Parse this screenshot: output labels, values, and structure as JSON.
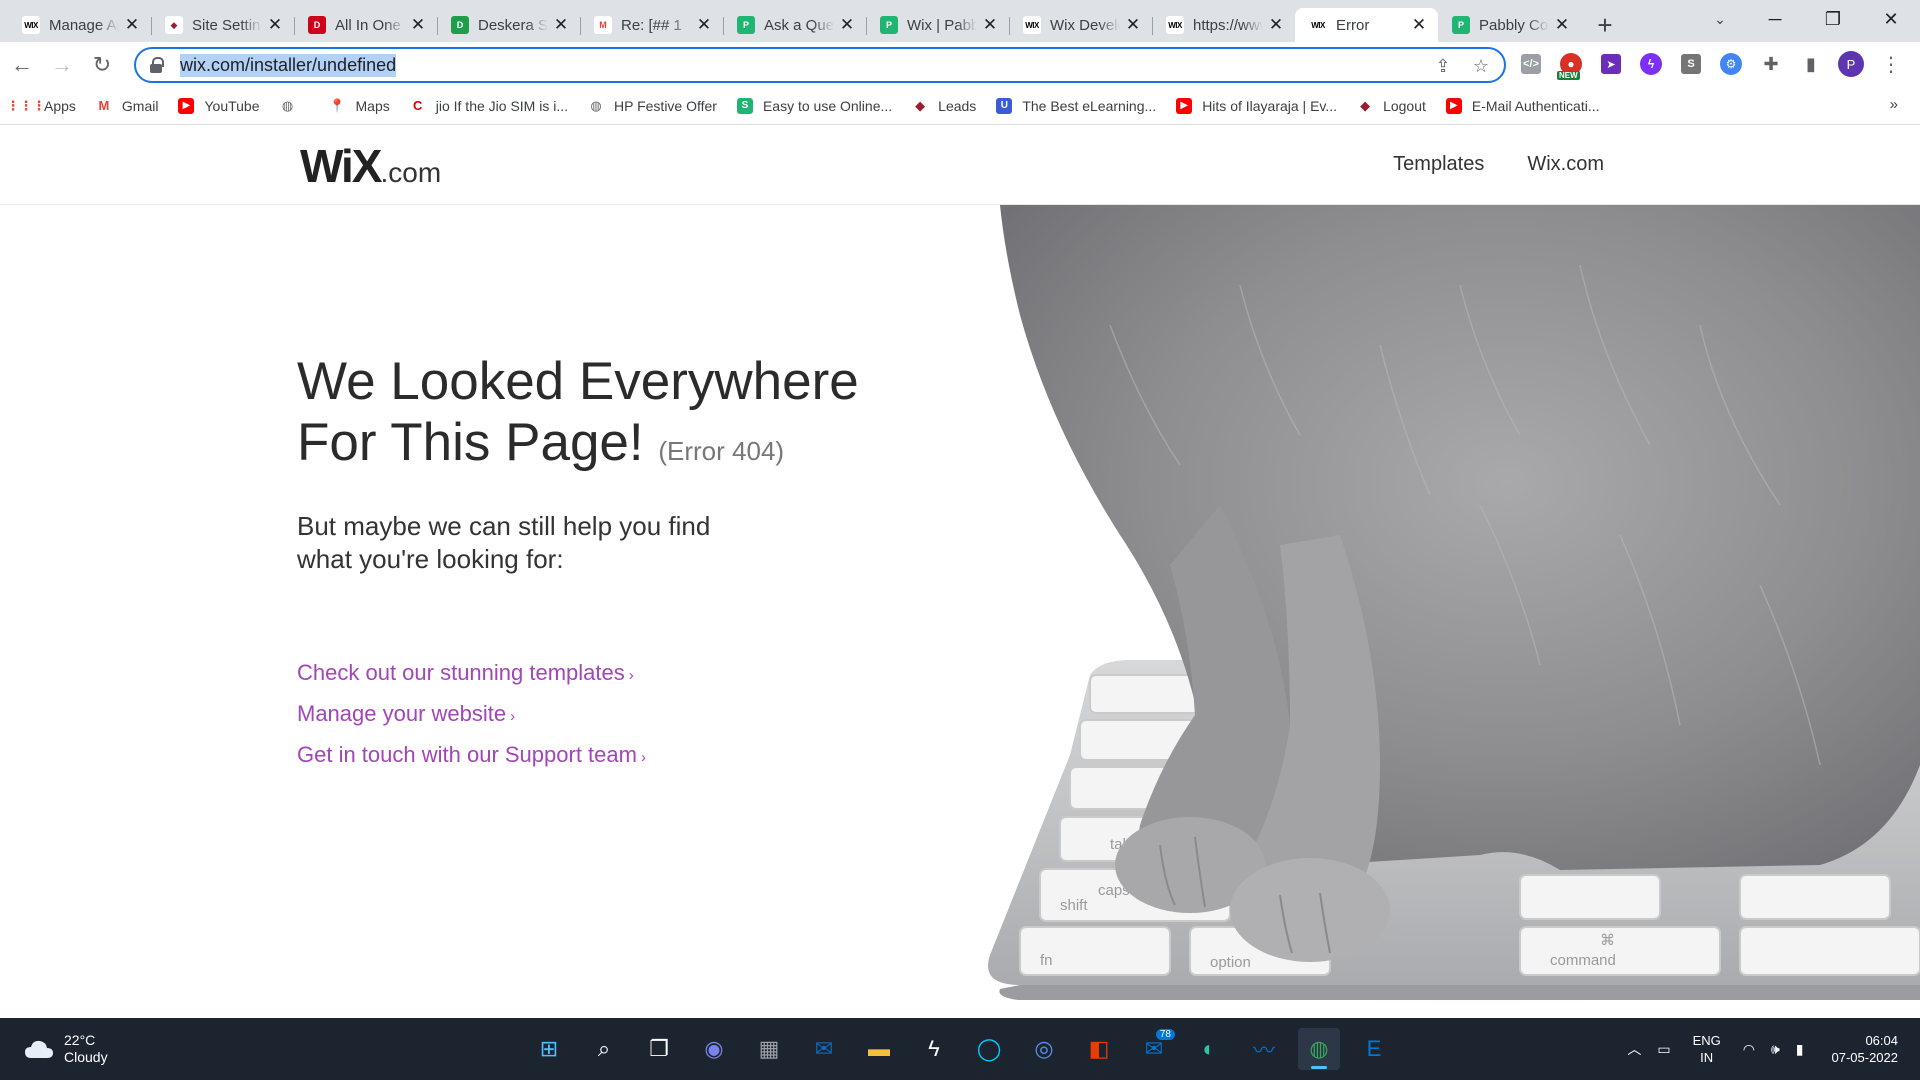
{
  "browser": {
    "tabs": [
      {
        "title": "Manage Apps",
        "favicon": "WIX",
        "fav_bg": "#ffffff",
        "fav_fg": "#000000",
        "active": false
      },
      {
        "title": "Site Settings",
        "favicon": "◆",
        "fav_bg": "#ffffff",
        "fav_fg": "#9b1c31",
        "active": false
      },
      {
        "title": "All In One",
        "favicon": "D",
        "fav_bg": "#d0021b",
        "fav_fg": "#ffffff",
        "active": false
      },
      {
        "title": "Deskera Sign",
        "favicon": "D",
        "fav_bg": "#1e9e4a",
        "fav_fg": "#ffffff",
        "active": false
      },
      {
        "title": "Re: [## 1",
        "favicon": "M",
        "fav_bg": "#ffffff",
        "fav_fg": "#ea4335",
        "active": false
      },
      {
        "title": "Ask a Question",
        "favicon": "P",
        "fav_bg": "#21b573",
        "fav_fg": "#ffffff",
        "active": false
      },
      {
        "title": "Wix | Pabbly",
        "favicon": "P",
        "fav_bg": "#21b573",
        "fav_fg": "#ffffff",
        "active": false
      },
      {
        "title": "Wix Developers",
        "favicon": "WIX",
        "fav_bg": "#ffffff",
        "fav_fg": "#000000",
        "active": false
      },
      {
        "title": "https://www",
        "favicon": "WIX",
        "fav_bg": "#ffffff",
        "fav_fg": "#000000",
        "active": false
      },
      {
        "title": "Error",
        "favicon": "WIX",
        "fav_bg": "#ffffff",
        "fav_fg": "#000000",
        "active": true
      },
      {
        "title": "Pabbly Connect",
        "favicon": "P",
        "fav_bg": "#21b573",
        "fav_fg": "#ffffff",
        "active": false
      }
    ],
    "tab_close_glyph": "✕",
    "new_tab_glyph": "+",
    "tab_search_glyph": "⌄",
    "window": {
      "minimize": "─",
      "maximize": "❐",
      "close": "✕"
    },
    "nav": {
      "back": "←",
      "forward": "→",
      "reload": "↻"
    },
    "address": {
      "url": "wix.com/installer/undefined",
      "share_glyph": "⇪",
      "star_glyph": "☆"
    },
    "extensions": [
      {
        "name": "code-extension",
        "glyph": "</>",
        "bg": "#9aa0a6",
        "shape": "sq"
      },
      {
        "name": "new-extension",
        "glyph": "●",
        "bg": "#d93025",
        "shape": "dot",
        "badge": "NEW"
      },
      {
        "name": "send-extension",
        "glyph": "➤",
        "bg": "#6c2eb9",
        "shape": "sq"
      },
      {
        "name": "bolt-extension",
        "glyph": "ϟ",
        "bg": "#7b2ff7",
        "shape": "dot"
      },
      {
        "name": "script-extension",
        "glyph": "S",
        "bg": "#757575",
        "shape": "sq"
      },
      {
        "name": "gear-extension",
        "glyph": "⚙",
        "bg": "#4285f4",
        "shape": "dot"
      }
    ],
    "puzzle_glyph": "✚",
    "sidepanel_glyph": "▮",
    "profile_initial": "P",
    "menu_glyph": "⋮",
    "bookmarks": [
      {
        "label": "Apps",
        "icon": "⋮⋮⋮",
        "bg": "#ffffff",
        "fg": "#ea4335"
      },
      {
        "label": "Gmail",
        "icon": "M",
        "bg": "#ffffff",
        "fg": "#ea4335"
      },
      {
        "label": "YouTube",
        "icon": "▶",
        "bg": "#ff0000",
        "fg": "#ffffff"
      },
      {
        "label": "",
        "icon": "◍",
        "bg": "#ffffff",
        "fg": "#5f6368"
      },
      {
        "label": "Maps",
        "icon": "📍",
        "bg": "#ffffff",
        "fg": "#34a853"
      },
      {
        "label": "jio If the Jio SIM is i...",
        "icon": "C",
        "bg": "#ffffff",
        "fg": "#d50000"
      },
      {
        "label": "HP Festive Offer",
        "icon": "◍",
        "bg": "#ffffff",
        "fg": "#5f6368"
      },
      {
        "label": "Easy to use Online...",
        "icon": "S",
        "bg": "#21b573",
        "fg": "#ffffff"
      },
      {
        "label": "Leads",
        "icon": "◆",
        "bg": "#ffffff",
        "fg": "#9b1c31"
      },
      {
        "label": "The Best eLearning...",
        "icon": "U",
        "bg": "#3b5bdb",
        "fg": "#ffffff"
      },
      {
        "label": "Hits of Ilayaraja | Ev...",
        "icon": "▶",
        "bg": "#ff0000",
        "fg": "#ffffff"
      },
      {
        "label": "Logout",
        "icon": "◆",
        "bg": "#ffffff",
        "fg": "#9b1c31"
      },
      {
        "label": "E-Mail Authenticati...",
        "icon": "▶",
        "bg": "#ff0000",
        "fg": "#ffffff"
      }
    ],
    "bookmarks_more": "»"
  },
  "site": {
    "logo_main": "WiX",
    "logo_suffix": ".com",
    "nav": [
      {
        "label": "Templates"
      },
      {
        "label": "Wix.com"
      }
    ],
    "headline_line1": "We Looked Everywhere",
    "headline_line2": "For This Page!",
    "error_code": "(Error 404)",
    "sub_line1": "But maybe we can still help you find",
    "sub_line2": "what you're looking for:",
    "links": [
      {
        "label": "Check out our stunning templates"
      },
      {
        "label": "Manage your website"
      },
      {
        "label": "Get in touch with our Support team"
      }
    ],
    "link_chevron": "›",
    "keyboard_keys": [
      "tab",
      "caps",
      "shift",
      "fn",
      "option",
      "command",
      "⌘"
    ]
  },
  "taskbar": {
    "weather_temp": "22°C",
    "weather_desc": "Cloudy",
    "apps": [
      {
        "name": "start-icon",
        "glyph": "⊞",
        "color": "#4cc2ff"
      },
      {
        "name": "search-icon",
        "glyph": "⌕",
        "color": "#ffffff"
      },
      {
        "name": "task-view-icon",
        "glyph": "❐",
        "color": "#ffffff"
      },
      {
        "name": "chat-icon",
        "glyph": "◉",
        "color": "#7b83eb"
      },
      {
        "name": "calculator-icon",
        "glyph": "▦",
        "color": "#9aa0a6"
      },
      {
        "name": "mail-icon",
        "glyph": "✉",
        "color": "#0f6cbd"
      },
      {
        "name": "file-explorer-icon",
        "glyph": "▬",
        "color": "#f3c13a"
      },
      {
        "name": "app-lightning-icon",
        "glyph": "ϟ",
        "color": "#ffffff"
      },
      {
        "name": "alexa-icon",
        "glyph": "◯",
        "color": "#00caff"
      },
      {
        "name": "cortana-icon",
        "glyph": "◎",
        "color": "#5b8def"
      },
      {
        "name": "office-icon",
        "glyph": "◧",
        "color": "#eb3c00"
      },
      {
        "name": "outlook-icon",
        "glyph": "✉",
        "color": "#0078d4",
        "badge": "78"
      },
      {
        "name": "edge-icon",
        "glyph": "◐",
        "color": "#2cc4a5"
      },
      {
        "name": "whiteboard-icon",
        "glyph": "〰",
        "color": "#0f6cbd"
      },
      {
        "name": "chrome-icon",
        "glyph": "◍",
        "color": "#34a853",
        "active": true
      },
      {
        "name": "e-app-icon",
        "glyph": "E",
        "color": "#0078d4"
      }
    ],
    "tray_chevron": "︿",
    "tray_display_glyph": "▭",
    "lang_line1": "ENG",
    "lang_line2": "IN",
    "wifi_glyph": "◠",
    "volume_glyph": "🕪",
    "battery_glyph": "▮",
    "time": "06:04",
    "date": "07-05-2022"
  }
}
